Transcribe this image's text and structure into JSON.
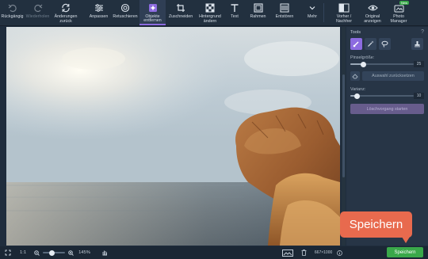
{
  "toolbar": {
    "undo": "Rückgängig",
    "redo": "Wiederholen",
    "changes_back": "Änderungen\nzurück",
    "adjust": "Anpassen",
    "retouch": "Retuschieren",
    "remove_objects": "Objekte\nentfernen",
    "crop": "Zuschneiden",
    "change_bg": "Hintergrund\nändern",
    "text": "Text",
    "frames": "Rahmen",
    "denoise": "Entstören",
    "more": "Mehr",
    "before_after": "Vorher /\nNachher",
    "show_original": "Original\nanzeigen",
    "photo_manager": "Photo\nManager",
    "new_badge": "New"
  },
  "panel": {
    "title": "Tools",
    "help": "?",
    "brush_size_label": "Pinselgröße:",
    "brush_size_value": "25",
    "brush_size_level": 0.2,
    "reset_selection": "Auswahl zurücksetzen",
    "variance_label": "Varianz:",
    "variance_value": "10",
    "variance_level": 0.1,
    "start_button": "Löschvorgang starten"
  },
  "statusbar": {
    "ratio": "1:1",
    "zoom": "145%",
    "dimensions": "667×1000",
    "save": "Speichern"
  },
  "callout": {
    "text": "Speichern"
  },
  "colors": {
    "accent": "#8c6be0",
    "save_green": "#3aa84a",
    "callout": "#e86a4e"
  }
}
